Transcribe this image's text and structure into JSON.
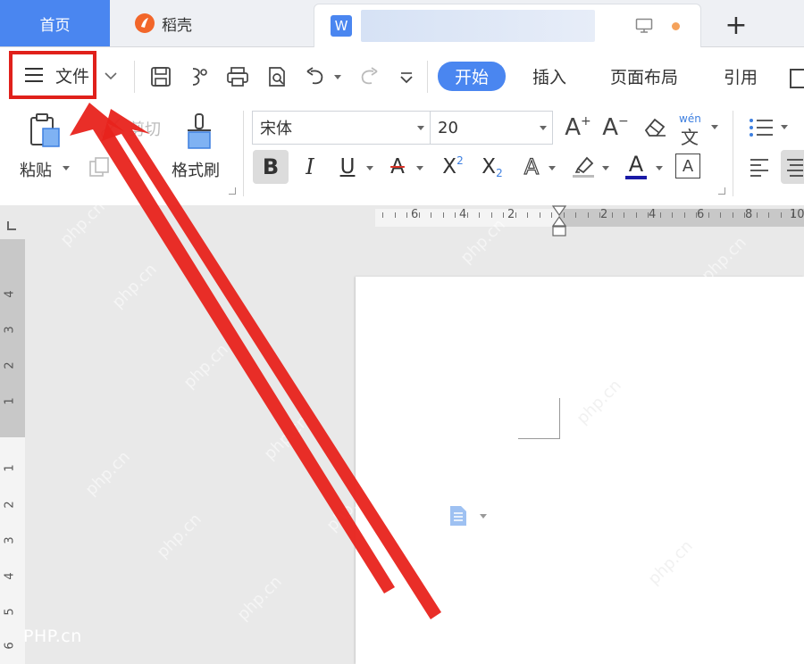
{
  "tabs": {
    "home": "首页",
    "daoke": "稻壳",
    "doc_icon": "W",
    "new_tab": "+"
  },
  "menu": {
    "file_label": "文件",
    "tabs": [
      {
        "label": "开始",
        "active": true
      },
      {
        "label": "插入",
        "active": false
      },
      {
        "label": "页面布局",
        "active": false
      },
      {
        "label": "引用",
        "active": false
      }
    ]
  },
  "ribbon": {
    "paste_label": "粘贴",
    "cut_label": "剪切",
    "format_painter_label": "格式刷",
    "font_name": "宋体",
    "font_size": "20",
    "bold": "B",
    "italic": "I",
    "underline": "U",
    "strike": "A",
    "superscript": "X",
    "sup_mark": "2",
    "subscript": "X",
    "sub_mark": "2",
    "text_effect": "A",
    "font_color": "A",
    "char_border": "A",
    "grow_font": "A",
    "grow_mark": "+",
    "shrink_font": "A",
    "shrink_mark": "−",
    "pinyin": "wén",
    "pinyin_char": "文"
  },
  "ruler": {
    "h_labels": [
      "6",
      "4",
      "2",
      "2",
      "4",
      "6",
      "8",
      "10"
    ],
    "v_labels": [
      "4",
      "3",
      "2",
      "1",
      "1",
      "2",
      "3",
      "4",
      "5",
      "6"
    ]
  },
  "watermark": {
    "text": "php.cn",
    "site": "PHP.cn"
  },
  "colors": {
    "accent": "#4a86f0",
    "highlight_box": "#e0201b",
    "arrow": "#e8231c",
    "font_color_bar": "#1a1aa6",
    "strike_color": "#d93025"
  }
}
